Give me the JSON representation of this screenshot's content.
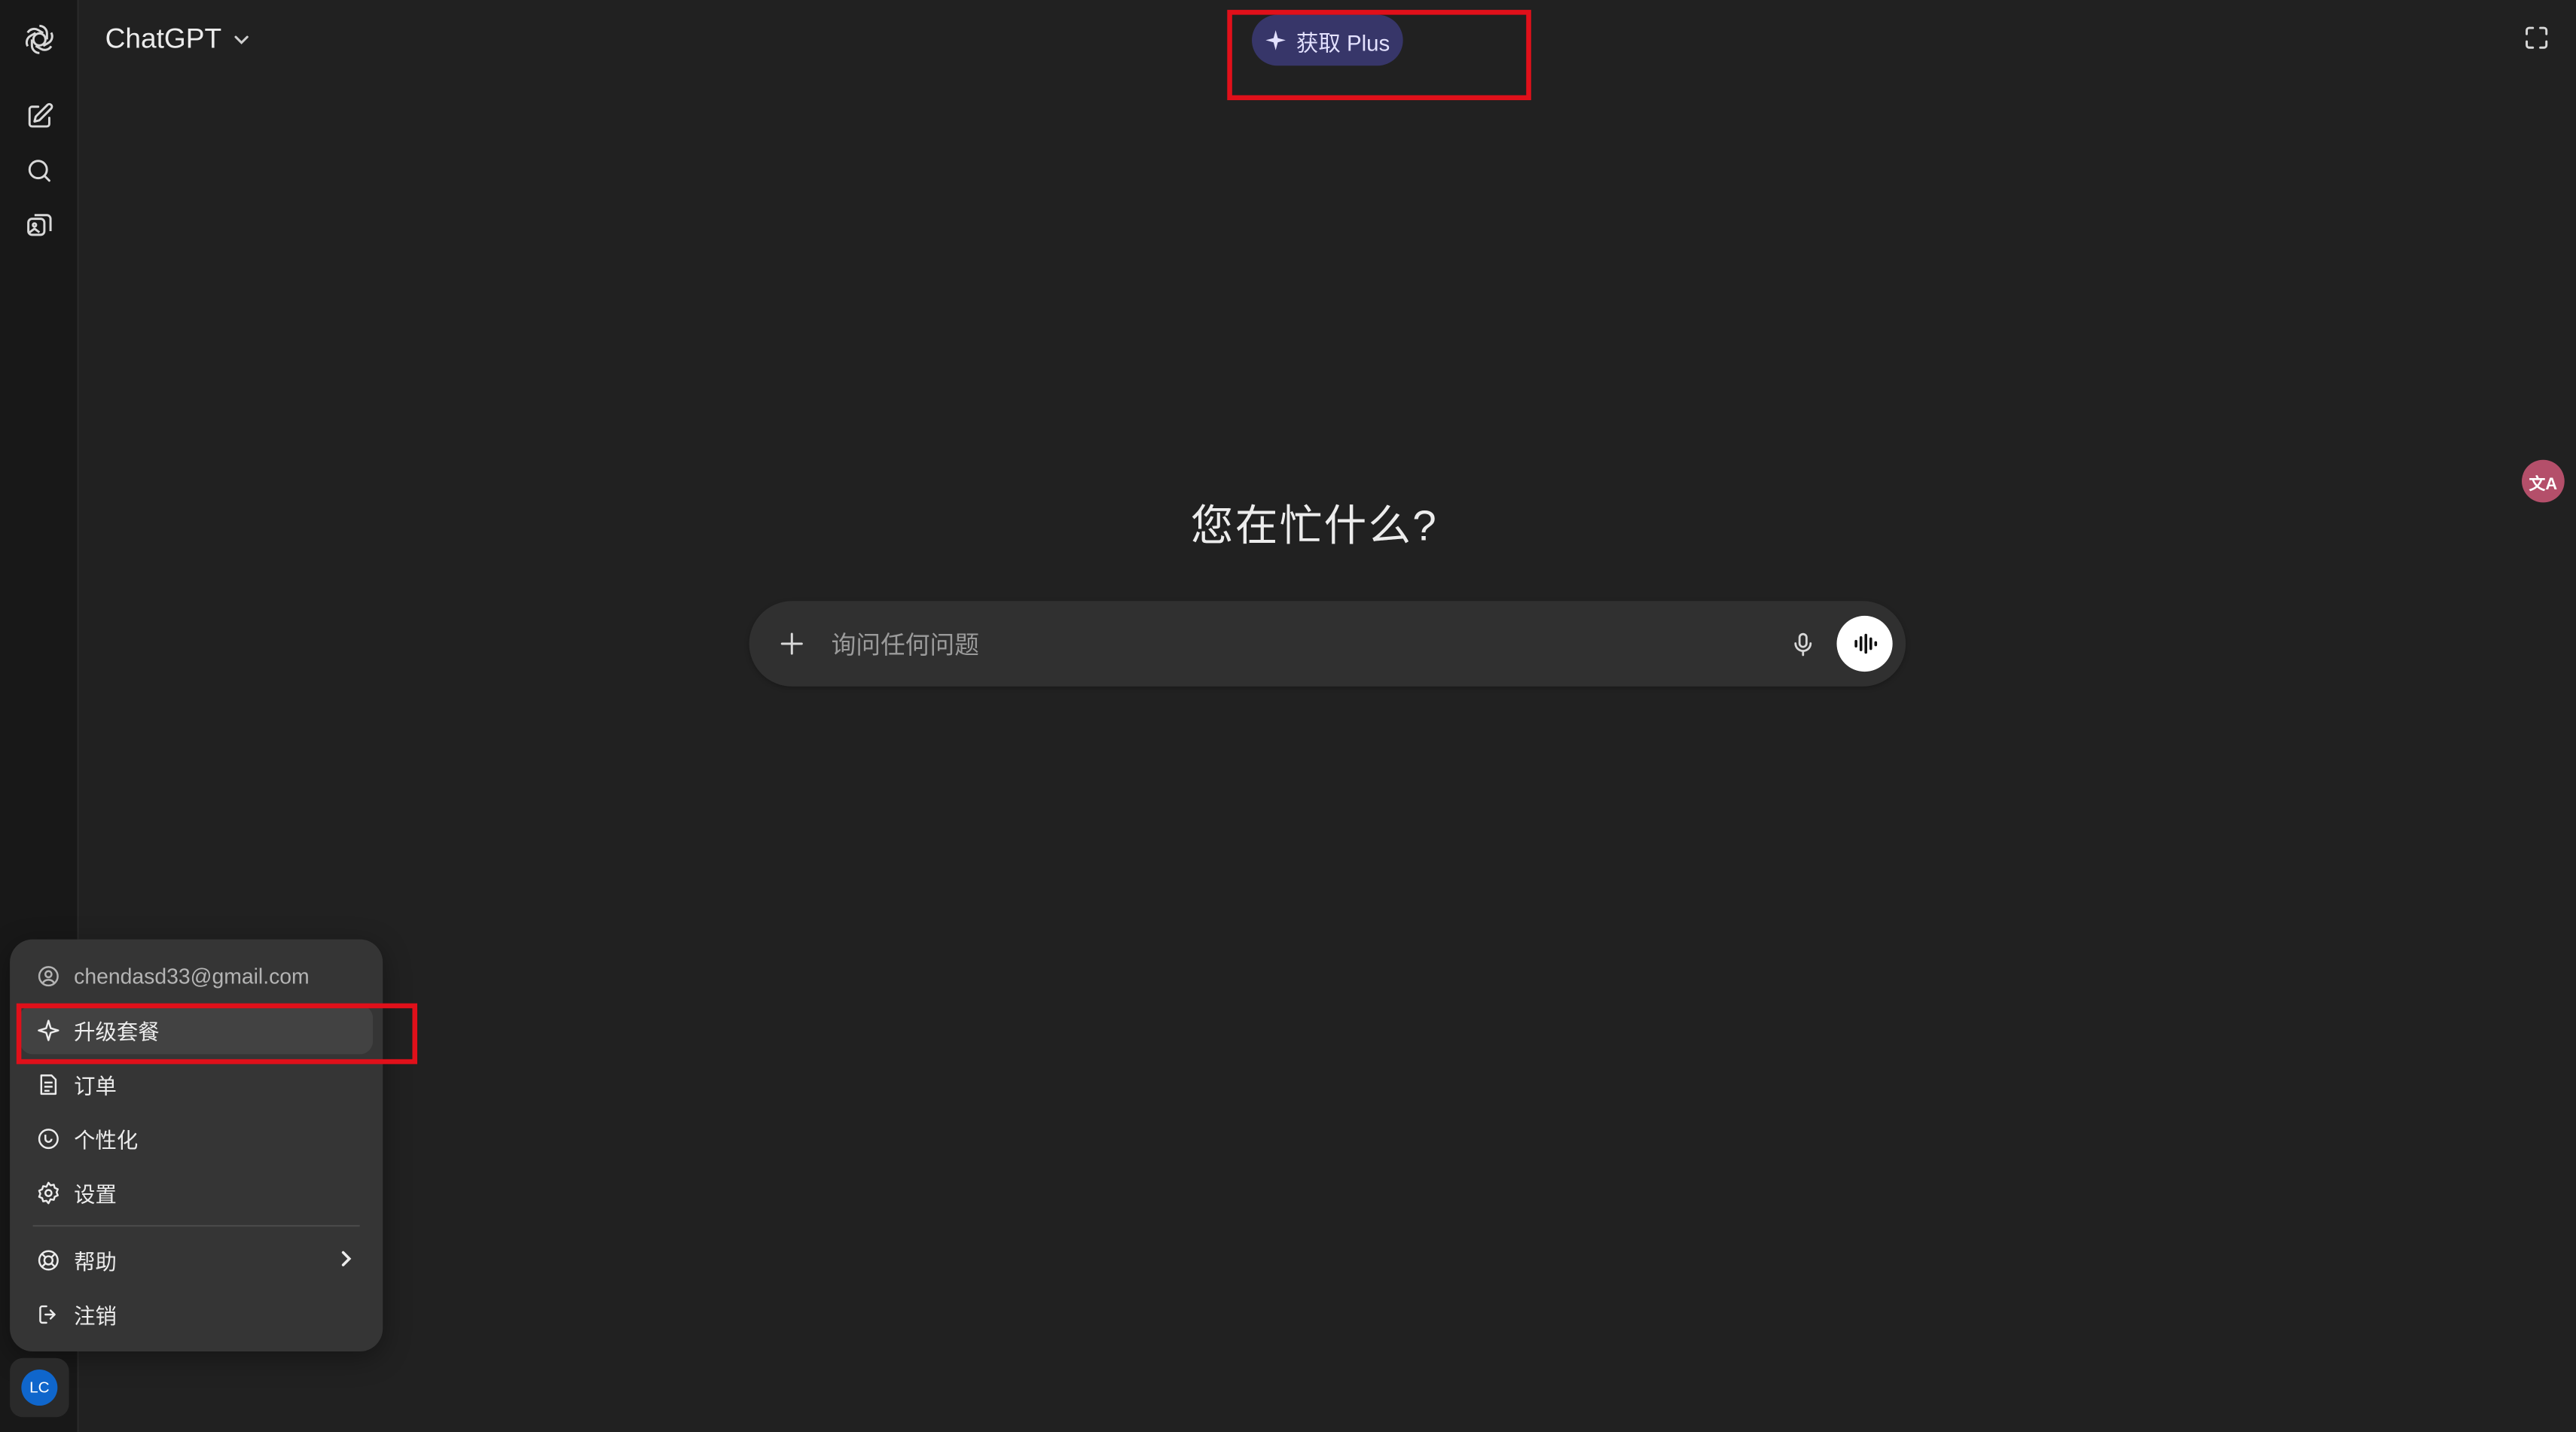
{
  "header": {
    "model_name": "ChatGPT",
    "get_plus_label": "获取 Plus"
  },
  "sidebar": {
    "icons": [
      "openai-logo-icon",
      "new-chat-icon",
      "search-icon",
      "library-icon"
    ]
  },
  "main": {
    "headline": "您在忙什么?",
    "composer": {
      "placeholder": "询问任何问题"
    }
  },
  "translate_badge": "文A",
  "account_menu": {
    "email": "chendasd33@gmail.com",
    "items": [
      {
        "label": "升级套餐",
        "icon": "sparkle-icon"
      },
      {
        "label": "订单",
        "icon": "orders-icon"
      },
      {
        "label": "个性化",
        "icon": "personalize-icon"
      },
      {
        "label": "设置",
        "icon": "settings-icon"
      },
      {
        "label": "帮助",
        "icon": "help-icon"
      },
      {
        "label": "注销",
        "icon": "logout-icon"
      }
    ]
  },
  "user": {
    "initials": "LC"
  },
  "colors": {
    "background": "#212121",
    "plus_pill": "#373669",
    "highlight": "#e0101a",
    "avatar": "#0f66cc"
  }
}
